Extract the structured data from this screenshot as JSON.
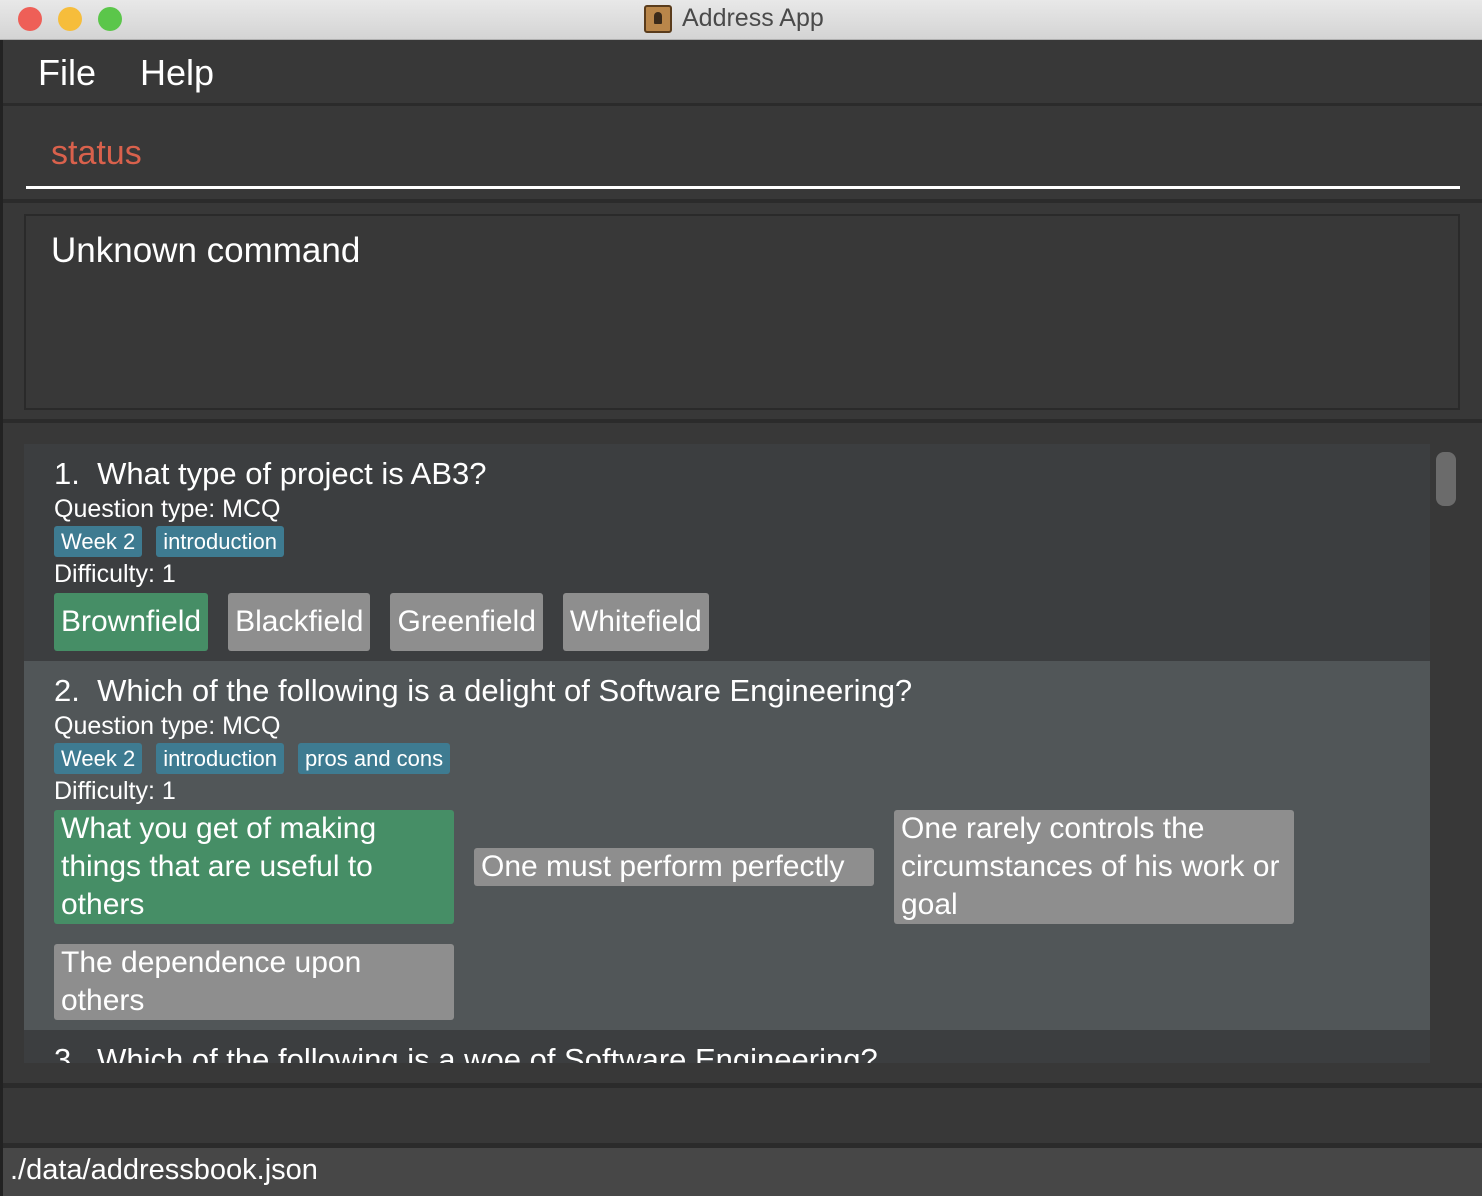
{
  "window": {
    "title": "Address App",
    "colors": {
      "close": "#ee5f57",
      "minimize": "#f6bd3b",
      "maximize": "#5bc64a"
    }
  },
  "menu": {
    "items": [
      "File",
      "Help"
    ]
  },
  "status": {
    "label": "status",
    "color": "#d9614c"
  },
  "result": {
    "text": "Unknown command"
  },
  "questions": [
    {
      "number": "1.",
      "text": "What type of project is AB3?",
      "type": "Question type: MCQ",
      "tags": [
        "Week 2",
        "introduction"
      ],
      "difficulty": "Difficulty: 1",
      "options": [
        {
          "text": "Brownfield",
          "correct": true
        },
        {
          "text": "Blackfield",
          "correct": false
        },
        {
          "text": "Greenfield",
          "correct": false
        },
        {
          "text": "Whitefield",
          "correct": false
        }
      ]
    },
    {
      "number": "2.",
      "text": "Which of the following is a delight of Software Engineering?",
      "type": "Question type: MCQ",
      "tags": [
        "Week 2",
        "introduction",
        "pros and cons"
      ],
      "difficulty": "Difficulty: 1",
      "options": [
        {
          "text": "What you get of making things that are useful to others",
          "correct": true
        },
        {
          "text": "One must perform perfectly",
          "correct": false
        },
        {
          "text": "One rarely controls the circumstances of his work or goal",
          "correct": false
        },
        {
          "text": "The dependence upon others",
          "correct": false
        }
      ]
    },
    {
      "number": "3.",
      "text": "Which of the following is a woe of Software Engineering?"
    }
  ],
  "footer": {
    "path": "./data/addressbook.json"
  },
  "colors": {
    "tag": "#3e7b91",
    "correct": "#468e66",
    "option": "#8e8e8e"
  }
}
